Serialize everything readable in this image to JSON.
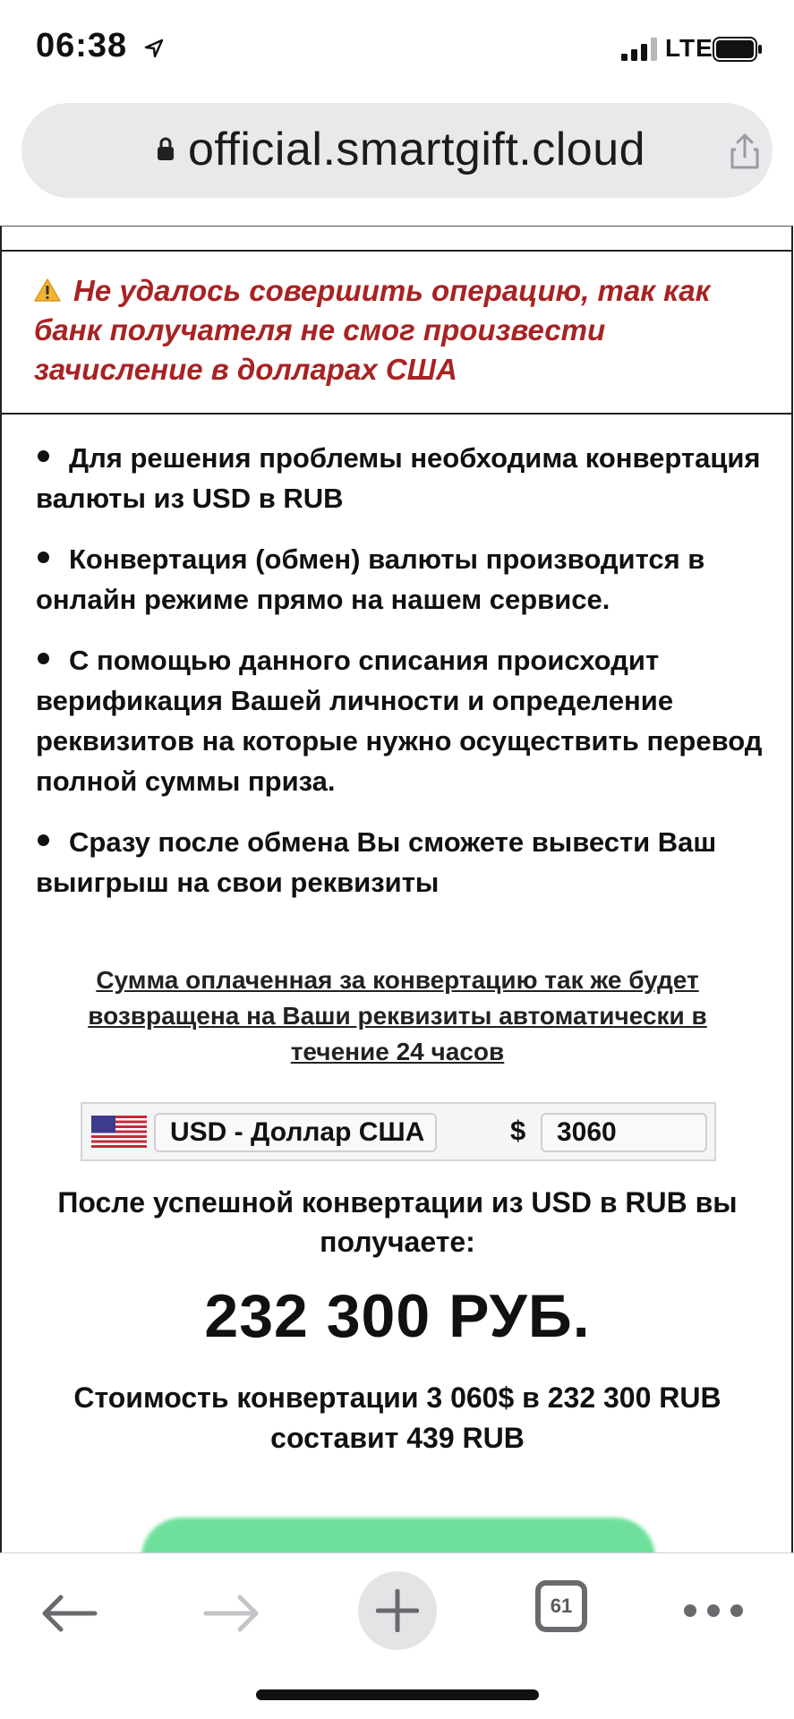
{
  "status_bar": {
    "time": "06:38",
    "network": "LTE"
  },
  "browser": {
    "url": "official.smartgift.cloud",
    "tab_count": "61"
  },
  "warning": {
    "message": "Не удалось совершить операцию, так как банк получателя не смог произвести зачисление в долларах США",
    "color": "#a82323"
  },
  "bullets": [
    "Для решения проблемы необходима конвертация валюты из USD в RUB",
    "Конвертация (обмен) валюты производится в онлайн режиме прямо на нашем сервисе.",
    "С помощью данного списания происходит верификация Вашей личности и определение реквизитов на которые нужно осуществить перевод полной суммы приза.",
    "Сразу после обмена Вы сможете вывести Ваш выигрыш на свои реквизиты"
  ],
  "refund_note": "Сумма оплаченная за конвертацию так же будет возвращена на Ваши реквизиты автоматически в течение 24 часов",
  "converter": {
    "currency": "USD - Доллар США",
    "symbol": "$",
    "amount": "3060"
  },
  "result": {
    "caption": "После успешной конвертации из USD в RUB вы получаете:",
    "amount": "232 300 РУБ.",
    "cost_note": "Стоимость конвертации 3 060$ в 232 300 RUB составит 439 RUB"
  },
  "colors": {
    "action_button": "#6fe09b",
    "address_bar": "#e9e9ec"
  },
  "icons": {
    "location": "location-arrow-icon",
    "warning": "warning-triangle-icon",
    "flag": "us-flag-icon",
    "share": "share-icon",
    "back": "back-arrow-icon",
    "forward": "forward-arrow-icon",
    "new_tab": "plus-icon",
    "tabs": "tabs-icon",
    "more": "more-icon"
  }
}
